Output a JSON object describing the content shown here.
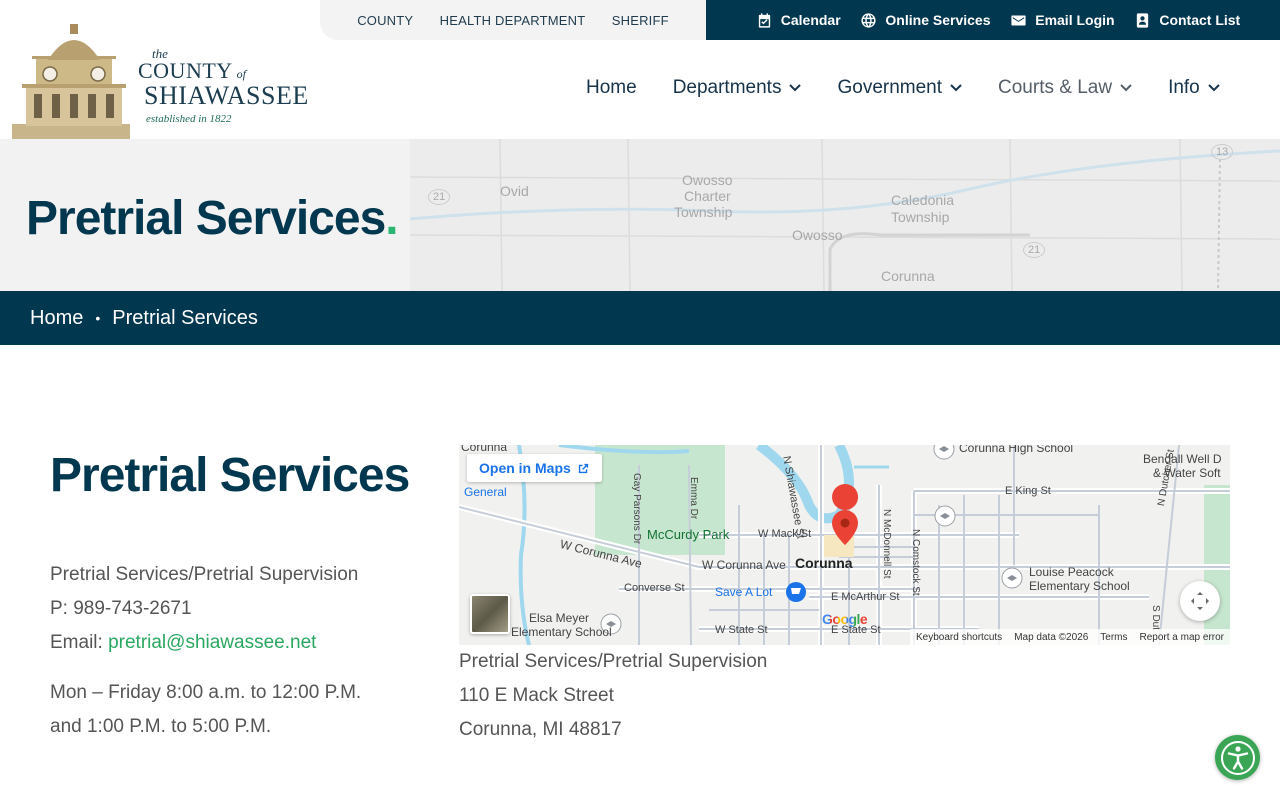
{
  "utility_nav": {
    "left_links": [
      "COUNTY",
      "HEALTH DEPARTMENT",
      "SHERIFF"
    ],
    "right_links": [
      {
        "label": "Calendar",
        "icon": "calendar-icon"
      },
      {
        "label": "Online Services",
        "icon": "globe-icon"
      },
      {
        "label": "Email Login",
        "icon": "mail-icon"
      },
      {
        "label": "Contact List",
        "icon": "contact-icon"
      }
    ]
  },
  "logo": {
    "the": "the",
    "county": "COUNTY",
    "of": "of",
    "name": "SHIAWASSEE",
    "established": "established in 1822"
  },
  "main_nav": [
    {
      "label": "Home",
      "dropdown": false
    },
    {
      "label": "Departments",
      "dropdown": true
    },
    {
      "label": "Government",
      "dropdown": true
    },
    {
      "label": "Courts & Law",
      "dropdown": true
    },
    {
      "label": "Info",
      "dropdown": true
    }
  ],
  "banner": {
    "title": "Pretrial Services",
    "dot": ".",
    "map_labels": [
      "Ovid",
      "Owosso",
      "Charter",
      "Township",
      "Caledonia",
      "Township",
      "Owosso",
      "Corunna",
      "21",
      "21",
      "13"
    ]
  },
  "breadcrumb": {
    "home": "Home",
    "separator": "•",
    "current": "Pretrial Services"
  },
  "content": {
    "title": "Pretrial Services",
    "line1": "Pretrial Services/Pretrial Supervision",
    "phone": "P: 989-743-2671",
    "email_label": "Email: ",
    "email": "pretrial@shiawassee.net",
    "hours1": "Mon – Friday 8:00 a.m. to 12:00 P.M.",
    "hours2": "and 1:00 P.M. to 5:00 P.M."
  },
  "map": {
    "open_label": "Open in Maps",
    "labels": {
      "corunna_top": "Corunna",
      "general": "General",
      "mccurdy": "McCurdy Park",
      "w_mack": "W Mack St",
      "w_corunna_ave1": "W Corunna Ave",
      "w_corunna_ave2": "W Corunna Ave",
      "corunna": "Corunna",
      "converse": "Converse St",
      "save_a_lot": "Save A Lot",
      "e_mcarthur": "E McArthur St",
      "elsa1": "Elsa Meyer",
      "elsa2": "Elementary School",
      "w_state": "W State St",
      "e_state": "E State St",
      "n_shiawassee": "N Shiawassee St",
      "corunna_hs": "Corunna High School",
      "e_king": "E King St",
      "bendall1": "Bendall Well D",
      "bendall2": "& Water Soft",
      "louise1": "Louise Peacock",
      "louise2": "Elementary School",
      "n_mcdonnell": "N McDonnell St",
      "n_comstock": "N Comstock St",
      "n_dutcher": "N Dutcher St",
      "emma": "Emma Dr",
      "gay_parsons": "Gay Parsons Dr",
      "s_dutcher": "S Dut"
    },
    "google": "Google",
    "footer": [
      "Keyboard shortcuts",
      "Map data ©2026",
      "Terms",
      "Report a map error"
    ]
  },
  "address": {
    "line1": "Pretrial Services/Pretrial Supervision",
    "line2": "110 E Mack Street",
    "line3": "Corunna, MI 48817"
  },
  "colors": {
    "navy": "#01374f",
    "green": "#2bb673",
    "link": "#2aa760"
  }
}
